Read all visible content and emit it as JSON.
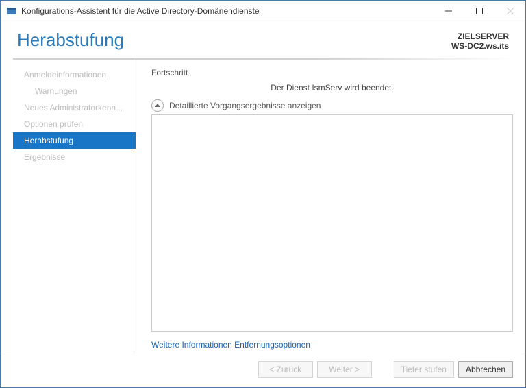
{
  "window": {
    "title": "Konfigurations-Assistent für die Active Directory-Domänendienste"
  },
  "header": {
    "title": "Herabstufung",
    "target_label": "ZIELSERVER",
    "target_value": "WS-DC2.ws.its"
  },
  "nav": {
    "items": [
      {
        "label": "Anmeldeinformationen",
        "indent": false,
        "active": false
      },
      {
        "label": "Warnungen",
        "indent": true,
        "active": false
      },
      {
        "label": "Neues Administratorkenn...",
        "indent": false,
        "active": false
      },
      {
        "label": "Optionen prüfen",
        "indent": false,
        "active": false
      },
      {
        "label": "Herabstufung",
        "indent": false,
        "active": true
      },
      {
        "label": "Ergebnisse",
        "indent": false,
        "active": false
      }
    ]
  },
  "content": {
    "section_title": "Fortschritt",
    "status": "Der Dienst IsmServ wird beendet.",
    "details_toggle": "Detaillierte Vorgangsergebnisse anzeigen",
    "link_text": "Weitere Informationen Entfernungsoptionen"
  },
  "footer": {
    "back": "< Zurück",
    "next": "Weiter >",
    "demote": "Tiefer stufen",
    "cancel": "Abbrechen"
  }
}
